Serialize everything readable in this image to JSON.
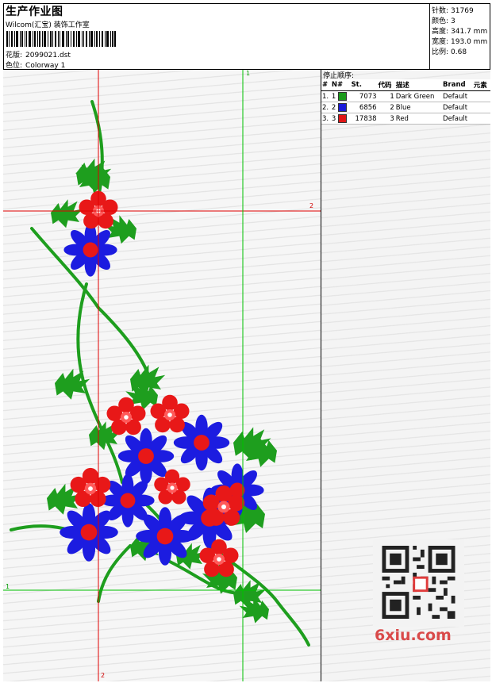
{
  "header": {
    "title": "生产作业图",
    "studio": "Wilcom(汇宝) 装饰工作室",
    "design_label": "花版:",
    "design_value": "2099021.dst",
    "colorway_label": "色位:",
    "colorway_value": "Colorway 1"
  },
  "stats": {
    "stitches_label": "针数:",
    "stitches_value": "31769",
    "colors_label": "颜色:",
    "colors_value": "3",
    "height_label": "高度:",
    "height_value": "341.7 mm",
    "width_label": "宽度:",
    "width_value": "193.0 mm",
    "scale_label": "比例:",
    "scale_value": "0.68"
  },
  "stop_sequence": {
    "title": "停止顺序:",
    "columns": [
      "#",
      "N#",
      "St.",
      "代码",
      "描述",
      "Brand",
      "元素"
    ],
    "rows": [
      {
        "idx": "1.",
        "n": "1",
        "color": "#1a9a1a",
        "st": "7073",
        "code": "1",
        "desc": "Dark Green",
        "brand": "Default"
      },
      {
        "idx": "2.",
        "n": "2",
        "color": "#1a1ad9",
        "st": "6856",
        "code": "2",
        "desc": "Blue",
        "brand": "Default"
      },
      {
        "idx": "3.",
        "n": "3",
        "color": "#e01515",
        "st": "17838",
        "code": "3",
        "desc": "Red",
        "brand": "Default"
      }
    ]
  },
  "guides": {
    "green_top": "1",
    "green_left": "1",
    "red_right": "2",
    "red_bottom": "2"
  },
  "colors": {
    "green": "#1e9e1e",
    "blue": "#1c1ce0",
    "red": "#e81818",
    "guide_red": "#e00000",
    "guide_green": "#00c000"
  },
  "watermark": "6xiu.com"
}
